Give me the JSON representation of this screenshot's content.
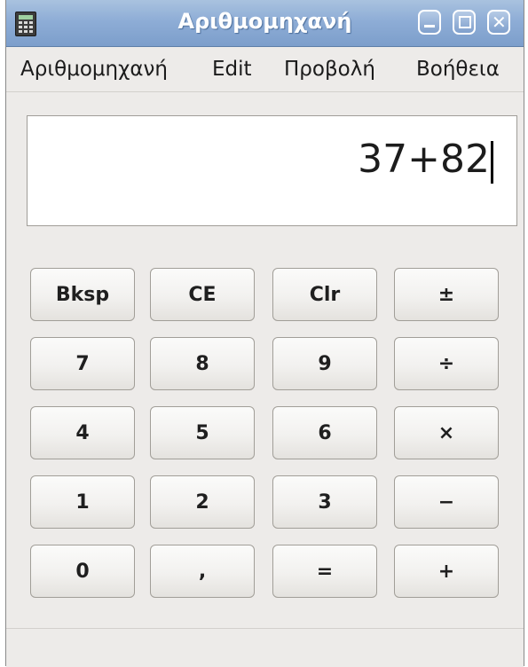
{
  "window": {
    "title": "Αριθμομηχανή",
    "icons": {
      "app": "calculator-icon",
      "minimize": "minimize-icon",
      "maximize": "maximize-icon",
      "close": "close-icon"
    },
    "close_glyph": "✕"
  },
  "menubar": {
    "items": [
      "Αριθμομηχανή",
      "Edit",
      "Προβολή",
      "Βοήθεια"
    ]
  },
  "display": {
    "value": "37+82"
  },
  "keypad": {
    "rows": [
      [
        "Bksp",
        "CE",
        "Clr",
        "±"
      ],
      [
        "7",
        "8",
        "9",
        "÷"
      ],
      [
        "4",
        "5",
        "6",
        "×"
      ],
      [
        "1",
        "2",
        "3",
        "−"
      ],
      [
        "0",
        ",",
        "=",
        "+"
      ]
    ]
  },
  "colors": {
    "titlebar_accent": "#8eadd6",
    "window_bg": "#edebe9",
    "display_bg": "#ffffff"
  }
}
